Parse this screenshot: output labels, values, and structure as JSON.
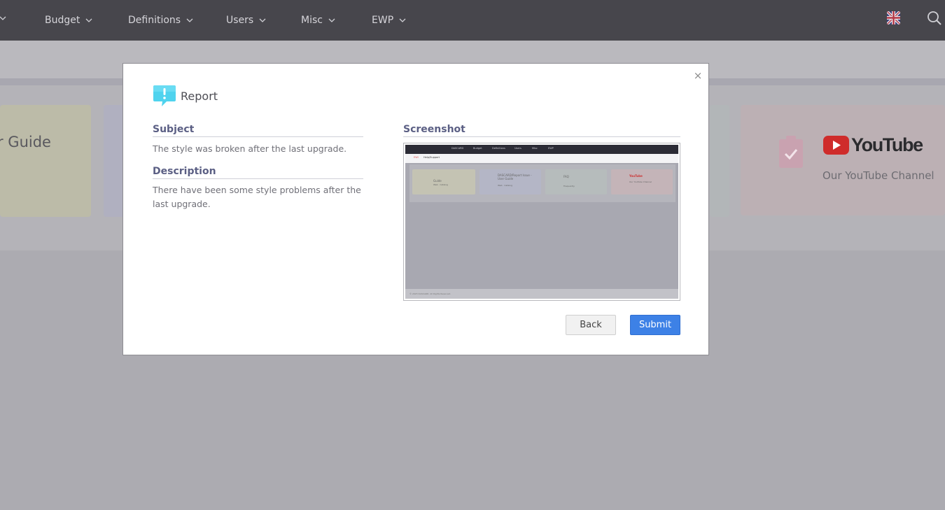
{
  "nav": {
    "items": [
      "Budget",
      "Definitions",
      "Users",
      "Misc",
      "EWP"
    ],
    "icons": {
      "dropdown": "chevron-down-icon",
      "language": "uk-flag-icon",
      "search": "search-icon"
    }
  },
  "background": {
    "guide_text": "r Guide",
    "youtube_logo_word": "YouTube",
    "youtube_subtitle": "Our YouTube Channel"
  },
  "modal": {
    "title": "Report",
    "title_icon": "speech-bubble-exclamation-icon",
    "close_label": "×",
    "subject_label": "Subject",
    "subject_value": "The style was broken after the last upgrade.",
    "description_label": "Description",
    "description_value": "There have been some style problems after the last upgrade.",
    "screenshot_label": "Screenshot",
    "back_label": "Back",
    "submit_label": "Submit"
  },
  "thumbnail": {
    "nav_items": [
      "DASCARD",
      "Budget",
      "Definitions",
      "Users",
      "Misc",
      "EWP"
    ],
    "header_x": "EWI",
    "header_title": "Help/Support",
    "cards": [
      {
        "title": "Guide",
        "sub": "Web · Catalog"
      },
      {
        "title": "DASCARD/Report Issue - User Guide",
        "sub": "Web · Catalog"
      },
      {
        "title": "FAQ",
        "sub": "Frequently"
      },
      {
        "title": "YouTube",
        "sub": "Our YouTube Channel"
      }
    ],
    "footer": "© 2023 DASCARD. All Rights Reserved."
  },
  "colors": {
    "nav_bg": "#47464c",
    "overlay": "#acabb1",
    "label": "#5b5f84",
    "primary": "#3d81e6",
    "youtube_red": "#d9312b"
  }
}
